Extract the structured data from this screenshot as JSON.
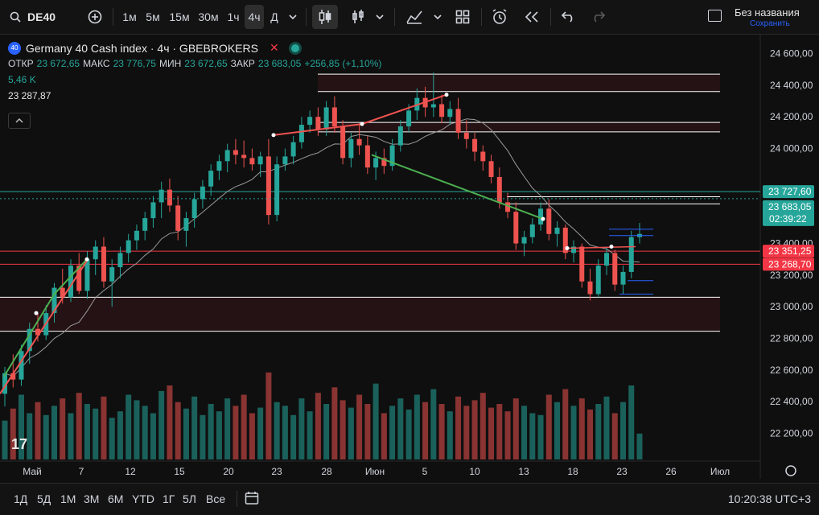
{
  "toolbar": {
    "symbol": "DE40",
    "intervals": [
      "1м",
      "5м",
      "15м",
      "30м",
      "1ч",
      "4ч",
      "Д"
    ],
    "active_interval": "4ч",
    "layout_name": "Без названия",
    "layout_save": "Сохранить"
  },
  "legend": {
    "title": "Germany 40 Cash index · 4ч · GBEBROKERS",
    "badge": "40",
    "open_label": "ОТКР",
    "open": "23 672,65",
    "high_label": "МАКС",
    "high": "23 776,75",
    "low_label": "МИН",
    "low": "23 672,65",
    "close_label": "ЗАКР",
    "close": "23 683,05",
    "change": "+256,85 (+1,10%)",
    "volume": "5,46 K",
    "ma_value": "23 287,87"
  },
  "bottombar": {
    "ranges": [
      "1Д",
      "5Д",
      "1М",
      "3М",
      "6М",
      "YTD",
      "1Г",
      "5Л",
      "Все"
    ],
    "time": "10:20:38 UTC+3"
  },
  "colors": {
    "up": "#26a69a",
    "down": "#ef5350",
    "bg": "#0f0f0f",
    "accent": "#2962ff"
  },
  "chart_data": {
    "type": "candlestick",
    "price_axis": {
      "ylim": [
        22050,
        24720
      ],
      "ticks": [
        22200,
        22400,
        22600,
        22800,
        23000,
        23200,
        23400,
        24000,
        24200,
        24400,
        24600
      ],
      "tick_labels": [
        "22 200,00",
        "22 400,00",
        "22 600,00",
        "22 800,00",
        "23 000,00",
        "23 200,00",
        "23 400,00",
        "24 000,00",
        "24 200,00",
        "24 400,00",
        "24 600,00"
      ]
    },
    "time_axis": {
      "labels": [
        "Май",
        "7",
        "12",
        "15",
        "20",
        "23",
        "28",
        "Июн",
        "5",
        "10",
        "13",
        "18",
        "23",
        "26",
        "Июл"
      ]
    },
    "price_labels": [
      {
        "text": "23 727,60",
        "value": 23727.6,
        "color": "#26a69a"
      },
      {
        "text": "23 683,05",
        "value": 23683.05,
        "color": "#26a69a",
        "sub": "02:39:22"
      },
      {
        "text": "23 351,25",
        "value": 23351.25,
        "color": "#f23645"
      },
      {
        "text": "23 268,70",
        "value": 23268.7,
        "color": "#f23645"
      }
    ],
    "horizontal_lines": [
      {
        "value": 24470,
        "color": "#ffffff"
      },
      {
        "value": 24360,
        "color": "#ffffff"
      },
      {
        "value": 24165,
        "color": "#ffffff"
      },
      {
        "value": 24105,
        "color": "#ffffff"
      },
      {
        "value": 23727.6,
        "color": "#26a69a"
      },
      {
        "value": 23695,
        "color": "#ffffff"
      },
      {
        "value": 23650,
        "color": "#ffffff"
      },
      {
        "value": 23351.25,
        "color": "#f23645"
      },
      {
        "value": 23268.7,
        "color": "#f23645"
      },
      {
        "value": 23060,
        "color": "#ffffff"
      },
      {
        "value": 22845,
        "color": "#ffffff"
      }
    ],
    "zones": [
      {
        "top": 24470,
        "bottom": 24360
      },
      {
        "top": 24165,
        "bottom": 24105
      },
      {
        "top": 23060,
        "bottom": 22845
      }
    ],
    "candles": [
      [
        22450,
        22620,
        22370,
        22580
      ],
      [
        22580,
        22700,
        22490,
        22540
      ],
      [
        22540,
        22760,
        22500,
        22720
      ],
      [
        22720,
        22900,
        22640,
        22860
      ],
      [
        22860,
        22960,
        22780,
        22820
      ],
      [
        22820,
        23010,
        22790,
        22960
      ],
      [
        22960,
        23150,
        22900,
        23120
      ],
      [
        23120,
        23240,
        23020,
        23060
      ],
      [
        23060,
        23300,
        23030,
        23260
      ],
      [
        23260,
        23340,
        23080,
        23100
      ],
      [
        23100,
        23350,
        23050,
        23300
      ],
      [
        23300,
        23420,
        23200,
        23380
      ],
      [
        23380,
        23440,
        23120,
        23160
      ],
      [
        23160,
        23300,
        23000,
        23250
      ],
      [
        23250,
        23380,
        23180,
        23340
      ],
      [
        23340,
        23460,
        23280,
        23420
      ],
      [
        23420,
        23520,
        23360,
        23480
      ],
      [
        23480,
        23600,
        23420,
        23560
      ],
      [
        23560,
        23700,
        23500,
        23660
      ],
      [
        23660,
        23790,
        23560,
        23740
      ],
      [
        23740,
        23810,
        23600,
        23640
      ],
      [
        23640,
        23700,
        23420,
        23480
      ],
      [
        23480,
        23600,
        23380,
        23560
      ],
      [
        23560,
        23720,
        23500,
        23680
      ],
      [
        23680,
        23800,
        23620,
        23760
      ],
      [
        23760,
        23900,
        23700,
        23860
      ],
      [
        23860,
        23960,
        23800,
        23920
      ],
      [
        23920,
        24030,
        23850,
        23990
      ],
      [
        23990,
        24060,
        23900,
        23960
      ],
      [
        23960,
        24050,
        23880,
        23940
      ],
      [
        23940,
        24000,
        23860,
        23900
      ],
      [
        23900,
        23980,
        23820,
        23950
      ],
      [
        23950,
        24060,
        23520,
        23580
      ],
      [
        23580,
        23950,
        23540,
        23900
      ],
      [
        23900,
        24000,
        23860,
        23950
      ],
      [
        23950,
        24080,
        23900,
        24040
      ],
      [
        24040,
        24200,
        24000,
        24150
      ],
      [
        24150,
        24240,
        24100,
        24200
      ],
      [
        24200,
        24260,
        24080,
        24120
      ],
      [
        24120,
        24300,
        24080,
        24260
      ],
      [
        24260,
        24330,
        24100,
        24140
      ],
      [
        24140,
        24180,
        23900,
        23940
      ],
      [
        23940,
        24100,
        23880,
        24060
      ],
      [
        24060,
        24160,
        23960,
        24020
      ],
      [
        24020,
        24080,
        23840,
        23880
      ],
      [
        23880,
        23980,
        23800,
        23940
      ],
      [
        23940,
        24000,
        23840,
        23890
      ],
      [
        23890,
        24060,
        23860,
        24020
      ],
      [
        24020,
        24180,
        23980,
        24140
      ],
      [
        24140,
        24280,
        24100,
        24240
      ],
      [
        24240,
        24380,
        24180,
        24320
      ],
      [
        24320,
        24390,
        24200,
        24260
      ],
      [
        24260,
        24480,
        24200,
        24280
      ],
      [
        24280,
        24340,
        24160,
        24200
      ],
      [
        24200,
        24300,
        24150,
        24250
      ],
      [
        24250,
        24320,
        24060,
        24100
      ],
      [
        24100,
        24180,
        24000,
        24060
      ],
      [
        24060,
        24100,
        23920,
        23980
      ],
      [
        23980,
        24020,
        23860,
        23920
      ],
      [
        23920,
        23960,
        23780,
        23820
      ],
      [
        23820,
        23880,
        23620,
        23660
      ],
      [
        23660,
        23720,
        23560,
        23600
      ],
      [
        23600,
        23660,
        23360,
        23400
      ],
      [
        23400,
        23480,
        23320,
        23440
      ],
      [
        23440,
        23560,
        23400,
        23520
      ],
      [
        23520,
        23660,
        23480,
        23620
      ],
      [
        23620,
        23680,
        23420,
        23460
      ],
      [
        23460,
        23540,
        23380,
        23500
      ],
      [
        23500,
        23520,
        23300,
        23340
      ],
      [
        23340,
        23420,
        23280,
        23380
      ],
      [
        23380,
        23400,
        23120,
        23160
      ],
      [
        23160,
        23240,
        23040,
        23080
      ],
      [
        23080,
        23300,
        23060,
        23260
      ],
      [
        23260,
        23380,
        23200,
        23340
      ],
      [
        23340,
        23360,
        23100,
        23140
      ],
      [
        23140,
        23260,
        23080,
        23220
      ],
      [
        23220,
        23480,
        23180,
        23440
      ],
      [
        23440,
        23530,
        23400,
        23460
      ]
    ],
    "volumes": [
      0.42,
      0.55,
      0.7,
      0.5,
      0.62,
      0.48,
      0.58,
      0.66,
      0.5,
      0.72,
      0.6,
      0.55,
      0.68,
      0.45,
      0.52,
      0.7,
      0.64,
      0.58,
      0.5,
      0.74,
      0.8,
      0.62,
      0.55,
      0.68,
      0.48,
      0.6,
      0.52,
      0.66,
      0.58,
      0.7,
      0.5,
      0.56,
      0.94,
      0.62,
      0.58,
      0.48,
      0.66,
      0.52,
      0.72,
      0.6,
      0.78,
      0.64,
      0.56,
      0.7,
      0.6,
      0.82,
      0.5,
      0.58,
      0.66,
      0.54,
      0.7,
      0.62,
      0.76,
      0.6,
      0.52,
      0.68,
      0.58,
      0.64,
      0.72,
      0.56,
      0.6,
      0.52,
      0.66,
      0.58,
      0.5,
      0.48,
      0.7,
      0.62,
      0.76,
      0.58,
      0.66,
      0.54,
      0.6,
      0.68,
      0.5,
      0.62,
      0.8,
      0.28
    ]
  }
}
